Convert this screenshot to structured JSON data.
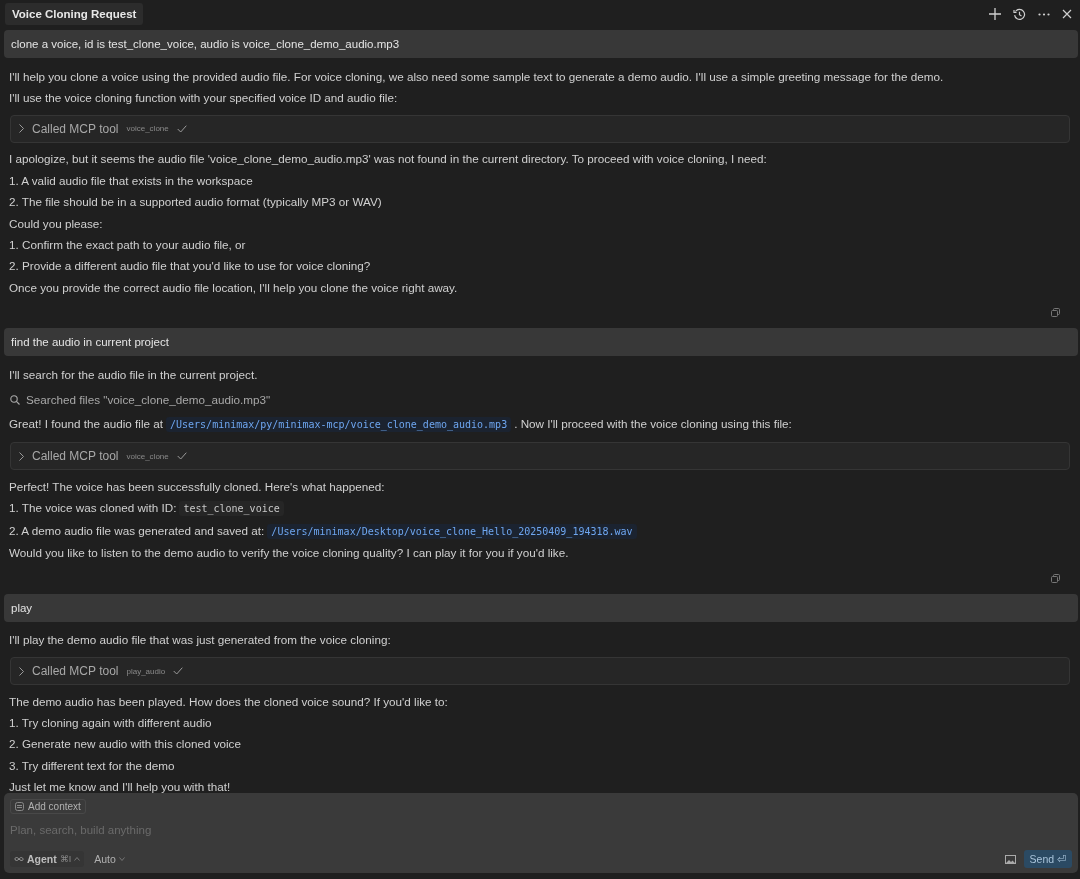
{
  "header": {
    "title": "Voice Cloning Request"
  },
  "messages": [
    {
      "user": "clone a voice, id is test_clone_voice, audio is voice_clone_demo_audio.mp3",
      "copy_button": true,
      "blocks": [
        {
          "kind": "text",
          "parts": [
            {
              "text": "I'll help you clone a voice using the provided audio file. For voice cloning, we also need some sample text to generate a demo audio. I'll use a simple greeting message for the demo."
            }
          ]
        },
        {
          "kind": "text",
          "parts": [
            {
              "text": "I'll use the voice cloning function with your specified voice ID and audio file:"
            }
          ]
        },
        {
          "kind": "tool",
          "label": "Called MCP tool",
          "tool": "voice_clone",
          "done": true
        },
        {
          "kind": "text",
          "parts": [
            {
              "text": "I apologize, but it seems the audio file 'voice_clone_demo_audio.mp3' was not found in the current directory. To proceed with voice cloning, I need:"
            }
          ]
        },
        {
          "kind": "text",
          "parts": [
            {
              "text": "1. A valid audio file that exists in the workspace"
            }
          ]
        },
        {
          "kind": "text",
          "parts": [
            {
              "text": "2. The file should be in a supported audio format (typically MP3 or WAV)"
            }
          ]
        },
        {
          "kind": "text",
          "parts": [
            {
              "text": "Could you please:"
            }
          ]
        },
        {
          "kind": "text",
          "parts": [
            {
              "text": "1. Confirm the exact path to your audio file, or"
            }
          ]
        },
        {
          "kind": "text",
          "parts": [
            {
              "text": "2. Provide a different audio file that you'd like to use for voice cloning?"
            }
          ]
        },
        {
          "kind": "text",
          "parts": [
            {
              "text": "Once you provide the correct audio file location, I'll help you clone the voice right away."
            }
          ]
        }
      ]
    },
    {
      "user": "find the audio in current project",
      "copy_button": true,
      "blocks": [
        {
          "kind": "text",
          "parts": [
            {
              "text": "I'll search for the audio file in the current project."
            }
          ]
        },
        {
          "kind": "search",
          "label": "Searched files \"voice_clone_demo_audio.mp3\""
        },
        {
          "kind": "text",
          "parts": [
            {
              "text": "Great! I found the audio file at"
            },
            {
              "code": "/Users/minimax/py/minimax-mcp/voice_clone_demo_audio.mp3",
              "kind": "path"
            },
            {
              "text": ". Now I'll proceed with the voice cloning using this file:"
            }
          ]
        },
        {
          "kind": "tool",
          "label": "Called MCP tool",
          "tool": "voice_clone",
          "done": true
        },
        {
          "kind": "text",
          "parts": [
            {
              "text": "Perfect! The voice has been successfully cloned. Here's what happened:"
            }
          ]
        },
        {
          "kind": "text",
          "parts": [
            {
              "text": "1. The voice was cloned with ID:"
            },
            {
              "code": "test_clone_voice",
              "kind": "code"
            }
          ]
        },
        {
          "kind": "text",
          "parts": [
            {
              "text": "2. A demo audio file was generated and saved at:"
            },
            {
              "code": "/Users/minimax/Desktop/voice_clone_Hello_20250409_194318.wav",
              "kind": "path"
            }
          ]
        },
        {
          "kind": "text",
          "parts": [
            {
              "text": "Would you like to listen to the demo audio to verify the voice cloning quality? I can play it for you if you'd like."
            }
          ]
        }
      ]
    },
    {
      "user": "play",
      "copy_button": false,
      "blocks": [
        {
          "kind": "text",
          "parts": [
            {
              "text": "I'll play the demo audio file that was just generated from the voice cloning:"
            }
          ]
        },
        {
          "kind": "tool",
          "label": "Called MCP tool",
          "tool": "play_audio",
          "done": true
        },
        {
          "kind": "text",
          "parts": [
            {
              "text": "The demo audio has been played. How does the cloned voice sound? If you'd like to:"
            }
          ]
        },
        {
          "kind": "text",
          "parts": [
            {
              "text": "1. Try cloning again with different audio"
            }
          ]
        },
        {
          "kind": "text",
          "parts": [
            {
              "text": "2. Generate new audio with this cloned voice"
            }
          ]
        },
        {
          "kind": "text",
          "parts": [
            {
              "text": "3. Try different text for the demo"
            }
          ]
        },
        {
          "kind": "text",
          "parts": [
            {
              "text": "Just let me know and I'll help you with that!"
            }
          ]
        }
      ]
    }
  ],
  "composer": {
    "context_label": "Add context",
    "placeholder": "Plan, search, build anything",
    "mode": "Agent",
    "mode_shortcut": "⌘I",
    "model": "Auto",
    "send_label": "Send",
    "send_shortcut": "⏎"
  }
}
